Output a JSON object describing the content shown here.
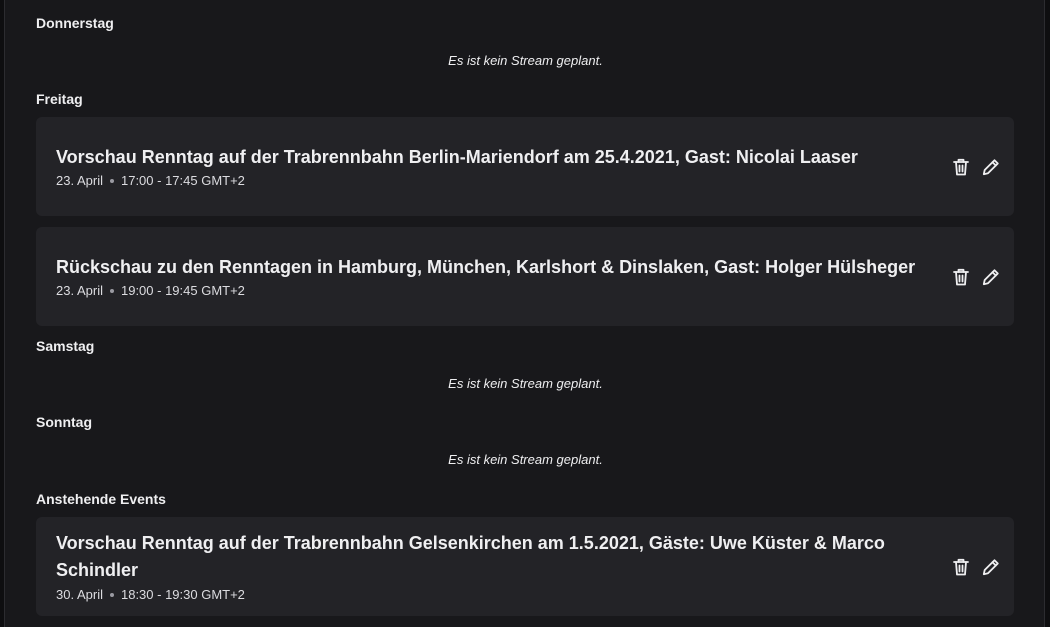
{
  "schedule": {
    "days": [
      {
        "name": "Donnerstag",
        "empty_text": "Es ist kein Stream geplant."
      },
      {
        "name": "Freitag"
      },
      {
        "name": "Samstag",
        "empty_text": "Es ist kein Stream geplant."
      },
      {
        "name": "Sonntag",
        "empty_text": "Es ist kein Stream geplant."
      }
    ],
    "events": [
      {
        "title": "Vorschau Renntag auf der Trabrennbahn Berlin-Mariendorf am 25.4.2021, Gast: Nicolai Laaser",
        "date": "23. April",
        "time": "17:00 - 17:45 GMT+2"
      },
      {
        "title": "Rückschau zu den Renntagen in Hamburg, München, Karlshort & Dinslaken, Gast: Holger Hülsheger",
        "date": "23. April",
        "time": "19:00 - 19:45 GMT+2"
      }
    ],
    "upcoming": {
      "heading": "Anstehende Events",
      "events": [
        {
          "title": "Vorschau Renntag auf der Trabrennbahn Gelsenkirchen am 1.5.2021, Gäste: Uwe Küster & Marco Schindler",
          "date": "30. April",
          "time": "18:30 - 19:30 GMT+2"
        }
      ]
    }
  },
  "icons": {
    "delete": "trash-icon",
    "edit": "pencil-icon"
  },
  "colors": {
    "background": "#18181b",
    "card": "#232327",
    "text": "#efeff1"
  }
}
